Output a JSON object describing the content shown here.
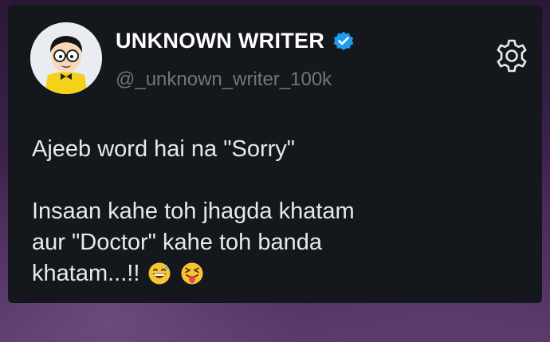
{
  "account": {
    "display_name": "UNKNOWN WRITER",
    "handle": "@_unknown_writer_100k",
    "verified": true,
    "verified_color": "#1d9bf0",
    "avatar_icon": "cartoon-boy-avatar"
  },
  "tweet": {
    "line1": "Ajeeb word hai na \"Sorry\"",
    "line2": "Insaan kahe toh jhagda khatam",
    "line3": "aur \"Doctor\" kahe toh banda",
    "line4": "khatam...!!",
    "emojis": [
      "grinning-sweat-emoji",
      "squinting-tongue-emoji"
    ]
  },
  "colors": {
    "card_bg": "#14171c",
    "text": "#e7e9ea",
    "handle_text": "#6e767d"
  }
}
